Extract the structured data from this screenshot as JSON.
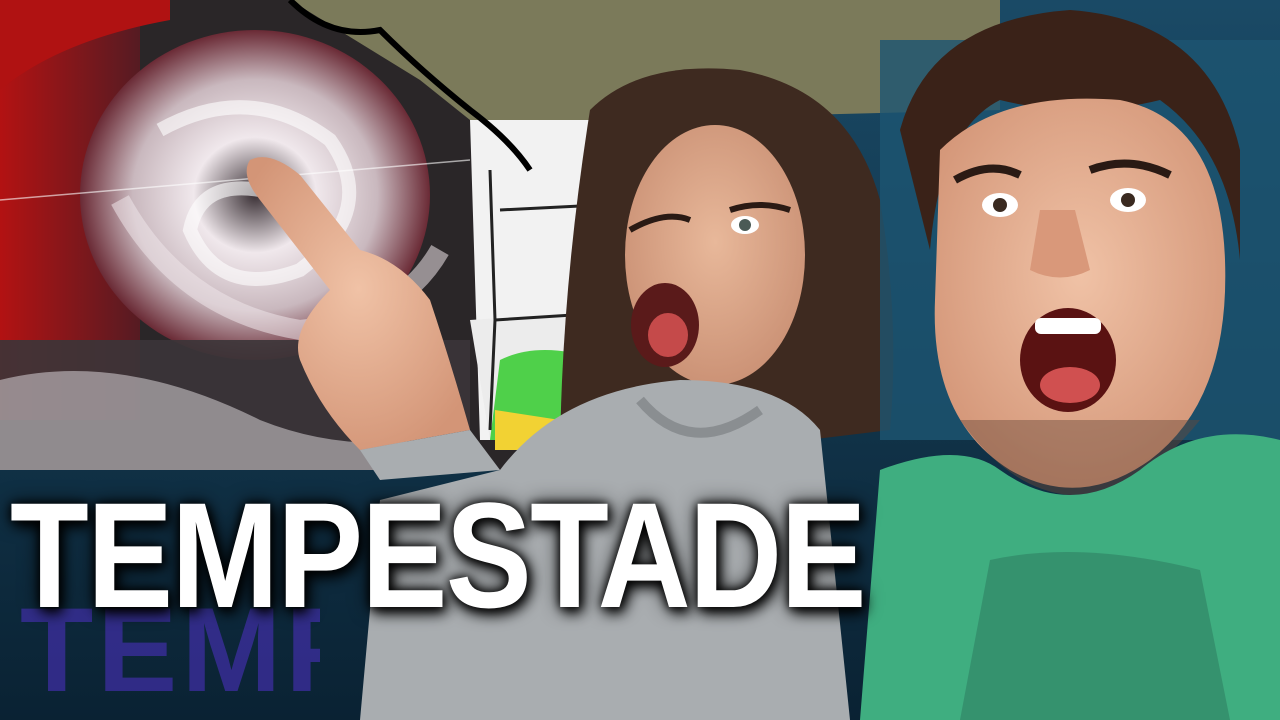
{
  "headline": "TEMPESTADE",
  "watermark": "TEMPESTADE",
  "colors": {
    "headline": "#ffffff",
    "background": "#0c2f45",
    "storm_red": "#b01212",
    "shirt_green": "#3fae80",
    "hoodie_gray": "#a9adb0"
  }
}
